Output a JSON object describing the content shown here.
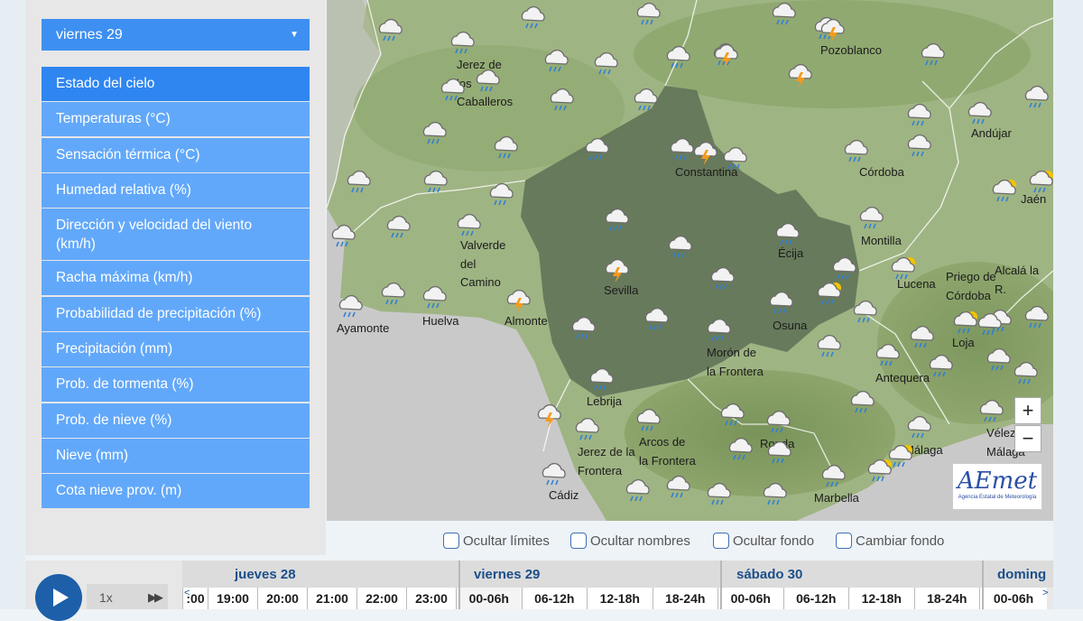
{
  "day_select": {
    "value": "viernes 29"
  },
  "menu": [
    {
      "label": "Estado del cielo",
      "active": true
    },
    {
      "label": "Temperaturas (°C)"
    },
    {
      "label": "Sensación térmica (°C)"
    },
    {
      "label": "Humedad relativa (%)"
    },
    {
      "label": "Dirección y velocidad del viento (km/h)"
    },
    {
      "label": "Racha máxima (km/h)"
    },
    {
      "label": "Probabilidad de precipitación (%)"
    },
    {
      "label": "Precipitación (mm)"
    },
    {
      "label": "Prob. de tormenta (%)"
    },
    {
      "label": "Prob. de nieve (%)"
    },
    {
      "label": "Nieve (mm)"
    },
    {
      "label": "Cota nieve prov. (m)"
    }
  ],
  "places": {
    "jerez_caballeros": "Jerez de\nlos\nCaballeros",
    "pozoblanco": "Pozoblanco",
    "andujar": "Andújar",
    "constantina": "Constantina",
    "cordoba": "Córdoba",
    "jaen": "Jaén",
    "valverde": "Valverde\ndel\nCamino",
    "ecija": "Écija",
    "montilla": "Montilla",
    "lucena": "Lucena",
    "priego": "Priego de\nCórdoba",
    "alcala": "Alcalá la\nR.",
    "sevilla": "Sevilla",
    "ayamonte": "Ayamonte",
    "huelva": "Huelva",
    "almonte": "Almonte",
    "osuna": "Osuna",
    "loja": "Loja",
    "moron": "Morón de\nla Frontera",
    "antequera": "Antequera",
    "lebrija": "Lebrija",
    "jerez_frontera": "Jerez de la\nFrontera",
    "arcos": "Arcos de\nla Frontera",
    "ronda": "Ronda",
    "velez": "Vélez-\nMálaga",
    "malaga": "Málaga",
    "cadiz": "Cádiz",
    "marbella": "Marbella"
  },
  "zoom": {
    "in": "+",
    "out": "−"
  },
  "logo": {
    "name": "AEmet",
    "subtitle": "Agencia Estatal de Meteorología"
  },
  "options": [
    "Ocultar límites",
    "Ocultar nombres",
    "Ocultar fondo",
    "Cambiar fondo"
  ],
  "player": {
    "speed": "1x",
    "ff": "▶▶"
  },
  "timeline": {
    "days": [
      "jueves 28",
      "viernes 29",
      "sábado 30",
      "doming"
    ],
    "hours_thu": [
      ":00",
      "19:00",
      "20:00",
      "21:00",
      "22:00",
      "23:00"
    ],
    "periods": [
      "00-06h",
      "06-12h",
      "12-18h",
      "18-24h"
    ],
    "sun_first": "00-06h",
    "prev": "<",
    "next": ">"
  },
  "colors": {
    "accent": "#3d8ff2",
    "menu": "#62a8fa",
    "nav_blue": "#1d5fa8"
  }
}
